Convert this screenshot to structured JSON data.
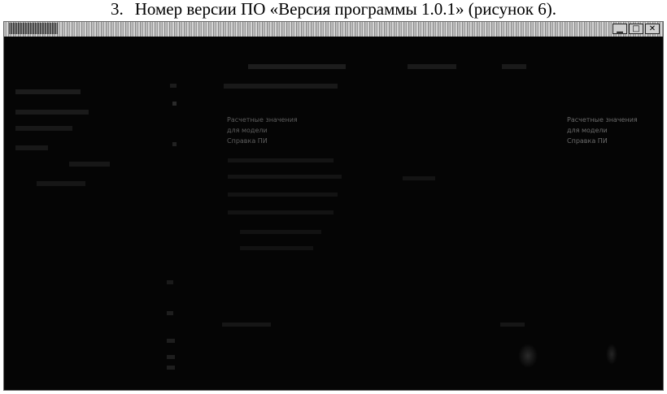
{
  "caption": {
    "number": "3.",
    "text": "Номер версии ПО «Версия программы 1.0.1» (рисунок 6)."
  },
  "window": {
    "controls": [
      "minimize-icon",
      "maximize-icon",
      "close-icon"
    ],
    "control_glyphs": [
      "▁",
      "□",
      "✕"
    ]
  },
  "content": {
    "column_a_lines": [
      "Расчетные значения",
      "для модели",
      "Справка ПИ"
    ],
    "column_b_lines": [
      "Расчетные значения",
      "для модели",
      "Справка ПИ"
    ]
  }
}
